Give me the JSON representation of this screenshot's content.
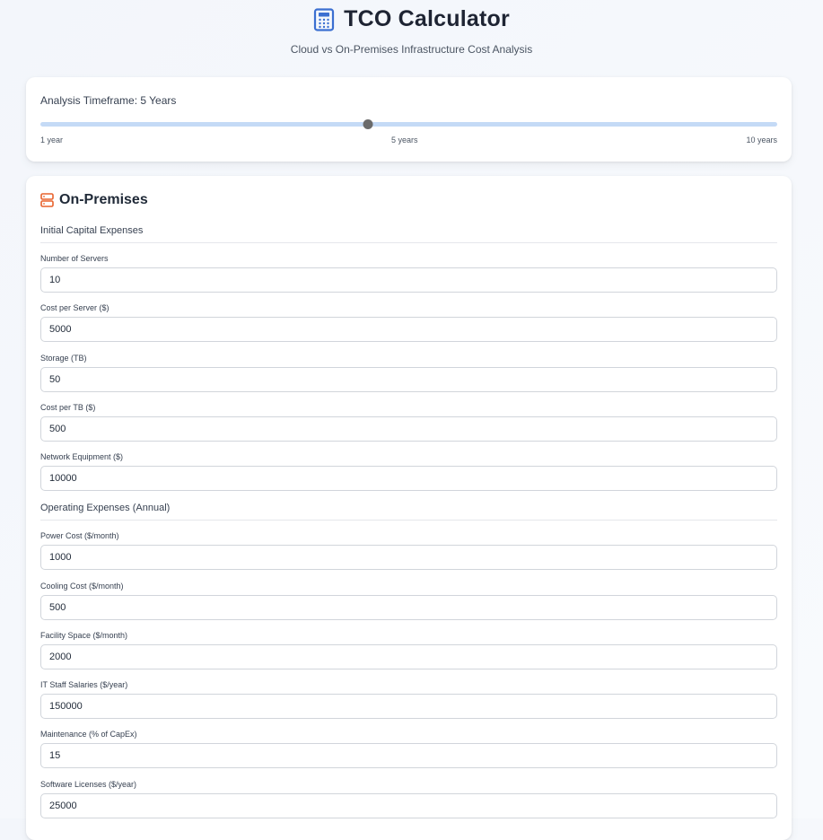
{
  "header": {
    "title": "TCO Calculator",
    "subtitle": "Cloud vs On-Premises Infrastructure Cost Analysis",
    "icon": "calculator-icon"
  },
  "timeframe": {
    "label": "Analysis Timeframe: 5 Years",
    "value_years": 5,
    "min_years": 1,
    "max_years": 10,
    "ticks": {
      "min": "1 year",
      "mid": "5 years",
      "max": "10 years"
    }
  },
  "onprem": {
    "title": "On-Premises",
    "icon": "server-icon",
    "capex_heading": "Initial Capital Expenses",
    "opex_heading": "Operating Expenses (Annual)",
    "capex_fields": [
      {
        "label": "Number of Servers",
        "value": "10"
      },
      {
        "label": "Cost per Server ($)",
        "value": "5000"
      },
      {
        "label": "Storage (TB)",
        "value": "50"
      },
      {
        "label": "Cost per TB ($)",
        "value": "500"
      },
      {
        "label": "Network Equipment ($)",
        "value": "10000"
      }
    ],
    "opex_fields": [
      {
        "label": "Power Cost ($/month)",
        "value": "1000"
      },
      {
        "label": "Cooling Cost ($/month)",
        "value": "500"
      },
      {
        "label": "Facility Space ($/month)",
        "value": "2000"
      },
      {
        "label": "IT Staff Salaries ($/year)",
        "value": "150000"
      },
      {
        "label": "Maintenance (% of CapEx)",
        "value": "15"
      },
      {
        "label": "Software Licenses ($/year)",
        "value": "25000"
      }
    ]
  },
  "colors": {
    "accent_icon": "#3b6fd1",
    "server_icon": "#e8622c",
    "slider_track": "#c4daf6",
    "slider_thumb": "#6b6b6b"
  }
}
